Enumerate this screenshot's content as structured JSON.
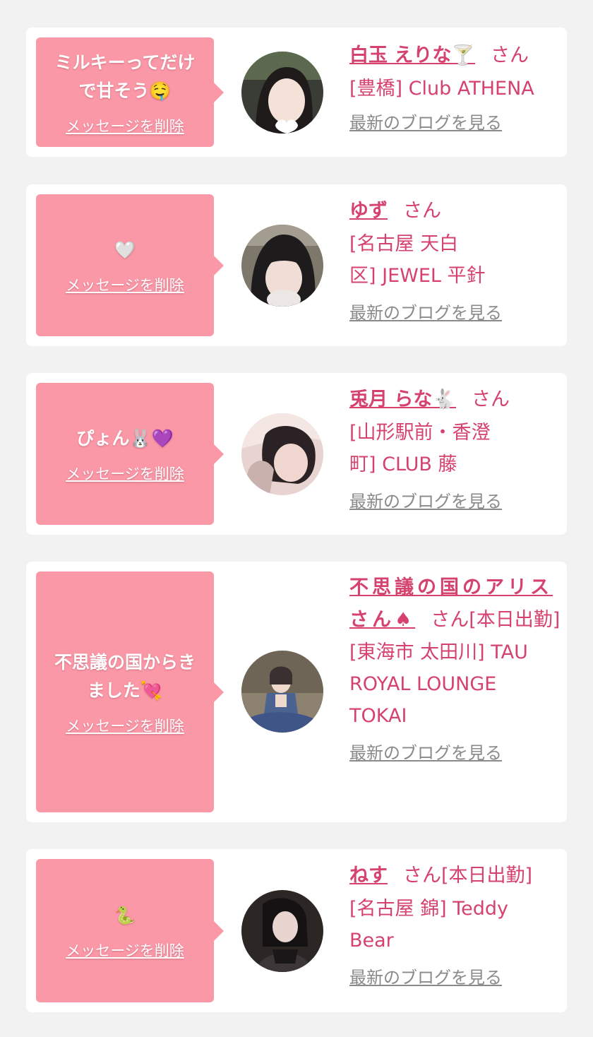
{
  "cards": [
    {
      "message": "ミルキーってだけ\nで甘そう🤤",
      "delete_label": "メッセージを削除",
      "name": "白玉 えりな🍸",
      "suffix": "さん",
      "shop": "[豊橋] Club ATHENA",
      "blog_label": "最新のブログを見る",
      "avatar_icon": "portrait-photo"
    },
    {
      "message": "🤍",
      "delete_label": "メッセージを削除",
      "name": "ゆず",
      "suffix": "さん",
      "shop": "[名古屋 天白\n区] JEWEL 平針",
      "blog_label": "最新のブログを見る",
      "avatar_icon": "portrait-photo"
    },
    {
      "message": "ぴょん🐰💜",
      "delete_label": "メッセージを削除",
      "name": "兎月 らな🐇",
      "suffix": "さん",
      "shop": "[山形駅前・香澄\n町] CLUB 藤",
      "blog_label": "最新のブログを見る",
      "avatar_icon": "portrait-photo"
    },
    {
      "message": "不思議の国からき\nました💘",
      "delete_label": "メッセージを削除",
      "name": "不思議の国のアリスさん♠",
      "suffix": "さん[本日出勤]",
      "shop": "[東海市 太田川] TAU\nROYAL LOUNGE\nTOKAI",
      "blog_label": "最新のブログを見る",
      "avatar_icon": "portrait-photo"
    },
    {
      "message": "🐍",
      "delete_label": "メッセージを削除",
      "name": "ねす",
      "suffix": "さん[本日出勤]",
      "shop": "[名古屋 錦] Teddy\nBear",
      "blog_label": "最新のブログを見る",
      "avatar_icon": "portrait-photo"
    }
  ],
  "colors": {
    "bubble": "#fb98a7",
    "accent": "#d6426e",
    "link_gray": "#8a8a8a",
    "background": "#f2f2f2"
  }
}
